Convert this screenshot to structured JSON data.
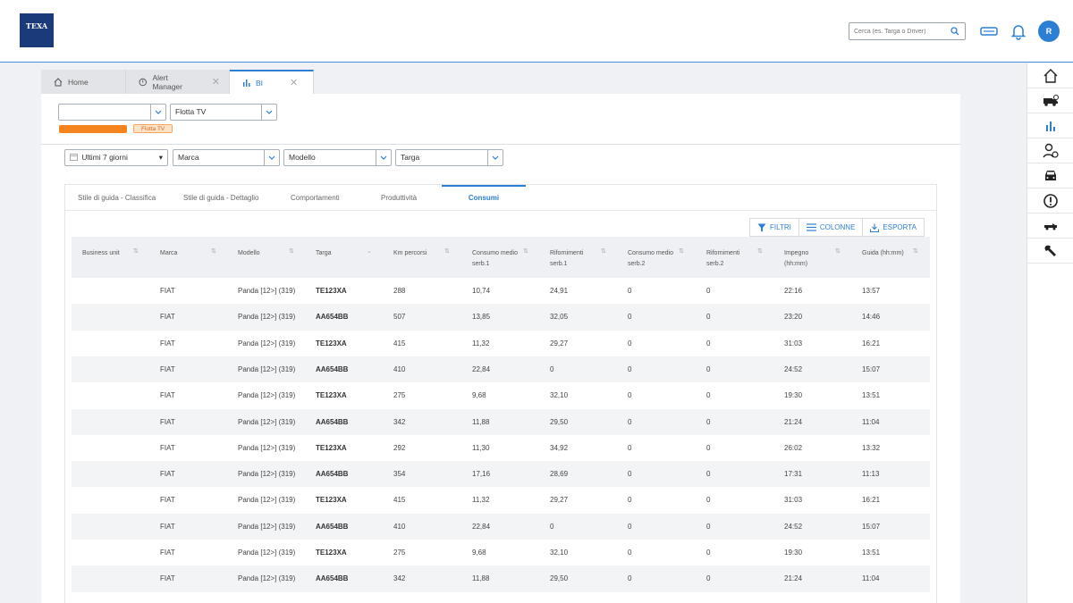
{
  "header": {
    "logo_text": "TEXA",
    "search_placeholder": "Cerca (es. Targa o Driver)",
    "avatar_initial": "R",
    "accent_color": "#2d7fd3"
  },
  "tabs": [
    {
      "label": "Home",
      "icon": "home-icon"
    },
    {
      "label": "Alert Manager",
      "icon": "alert-icon"
    },
    {
      "label": "BI",
      "icon": "bar-chart-icon"
    }
  ],
  "filters_top": {
    "company_value": "",
    "fleet_value": "Flotta TV",
    "fleet_chip": "Flotta TV"
  },
  "filters": {
    "period": "Ultimi 7 giorni",
    "brand": "Marca",
    "model": "Modello",
    "plate": "Targa"
  },
  "subtabs": [
    "Stile di guida - Classifica",
    "Stile di guida - Dettaglio",
    "Comportamenti",
    "Produttività",
    "Consumi"
  ],
  "actions": {
    "filters": "FILTRI",
    "columns": "COLONNE",
    "export": "ESPORTA"
  },
  "table": {
    "columns": [
      [
        "Business unit"
      ],
      [
        "Marca"
      ],
      [
        "Modello"
      ],
      [
        "Targa"
      ],
      [
        "Km percorsi"
      ],
      [
        "Consumo medio",
        "serb.1"
      ],
      [
        "Rifornimenti",
        "serb.1"
      ],
      [
        "Consumo medio",
        "serb.2"
      ],
      [
        "Rifornimenti",
        "serb.2"
      ],
      [
        "Impegno",
        "(hh:mm)"
      ],
      [
        "Guida (hh:mm)"
      ]
    ],
    "rows": [
      [
        "",
        "FIAT",
        "Panda [12>] (319)",
        "TE123XA",
        "288",
        "10,74",
        "24,91",
        "0",
        "0",
        "22:16",
        "13:57"
      ],
      [
        "",
        "FIAT",
        "Panda [12>] (319)",
        "AA654BB",
        "507",
        "13,85",
        "32,05",
        "0",
        "0",
        "23:20",
        "14:46"
      ],
      [
        "",
        "FIAT",
        "Panda [12>] (319)",
        "TE123XA",
        "415",
        "11,32",
        "29,27",
        "0",
        "0",
        "31:03",
        "16:21"
      ],
      [
        "",
        "FIAT",
        "Panda [12>] (319)",
        "AA654BB",
        "410",
        "22,84",
        "0",
        "0",
        "0",
        "24:52",
        "15:07"
      ],
      [
        "",
        "FIAT",
        "Panda [12>] (319)",
        "TE123XA",
        "275",
        "9,68",
        "32,10",
        "0",
        "0",
        "19:30",
        "13:51"
      ],
      [
        "",
        "FIAT",
        "Panda [12>] (319)",
        "AA654BB",
        "342",
        "11,88",
        "29,50",
        "0",
        "0",
        "21:24",
        "11:04"
      ],
      [
        "",
        "FIAT",
        "Panda [12>] (319)",
        "TE123XA",
        "292",
        "11,30",
        "34,92",
        "0",
        "0",
        "26:02",
        "13:32"
      ],
      [
        "",
        "FIAT",
        "Panda [12>] (319)",
        "AA654BB",
        "354",
        "17,16",
        "28,69",
        "0",
        "0",
        "17:31",
        "11:13"
      ],
      [
        "",
        "FIAT",
        "Panda [12>] (319)",
        "TE123XA",
        "415",
        "11,32",
        "29,27",
        "0",
        "0",
        "31:03",
        "16:21"
      ],
      [
        "",
        "FIAT",
        "Panda [12>] (319)",
        "AA654BB",
        "410",
        "22,84",
        "0",
        "0",
        "0",
        "24:52",
        "15:07"
      ],
      [
        "",
        "FIAT",
        "Panda [12>] (319)",
        "TE123XA",
        "275",
        "9,68",
        "32,10",
        "0",
        "0",
        "19:30",
        "13:51"
      ],
      [
        "",
        "FIAT",
        "Panda [12>] (319)",
        "AA654BB",
        "342",
        "11,88",
        "29,50",
        "0",
        "0",
        "21:24",
        "11:04"
      ]
    ]
  },
  "rail_icons": [
    "home-icon",
    "truck-icon",
    "bar-chart-icon",
    "driver-icon",
    "car-icon",
    "alert-icon",
    "van-icon",
    "wrench-icon"
  ]
}
